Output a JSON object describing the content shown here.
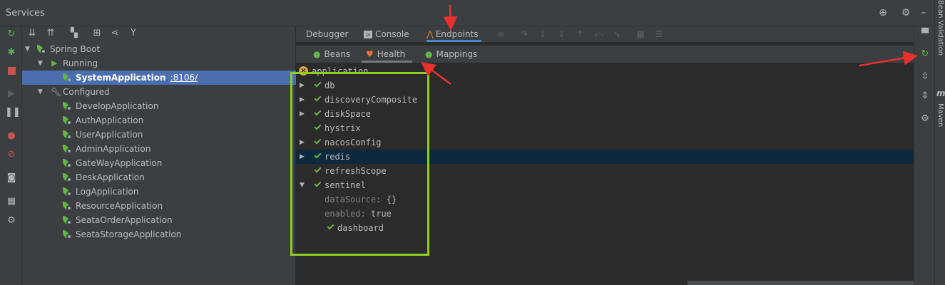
{
  "header": {
    "title": "Services"
  },
  "side_tabs": {
    "bean_validation": "Bean Validation",
    "maven": "Maven",
    "maven_glyph": "m"
  },
  "tree": {
    "spring_boot": "Spring Boot",
    "running": "Running",
    "running_app": {
      "name": "SystemApplication",
      "port": ":8106/"
    },
    "configured": "Configured",
    "configured_apps": [
      "DevelopApplication",
      "AuthApplication",
      "UserApplication",
      "AdminApplication",
      "GateWayApplication",
      "DeskApplication",
      "LogApplication",
      "ResourceApplication",
      "SeataOrderApplication",
      "SeataStorageApplication"
    ]
  },
  "tabs": {
    "debugger": "Debugger",
    "console": "Console",
    "endpoints": "Endpoints",
    "active": "Endpoints"
  },
  "subtabs": {
    "beans": "Beans",
    "health": "Health",
    "mappings": "Mappings",
    "active": "Health"
  },
  "health": {
    "root": "application",
    "components": [
      {
        "name": "db",
        "expandable": true
      },
      {
        "name": "discoveryComposite",
        "expandable": true
      },
      {
        "name": "diskSpace",
        "expandable": true
      },
      {
        "name": "hystrix",
        "expandable": false
      },
      {
        "name": "nacosConfig",
        "expandable": true
      },
      {
        "name": "redis",
        "expandable": true,
        "highlighted": true
      },
      {
        "name": "refreshScope",
        "expandable": false
      },
      {
        "name": "sentinel",
        "expandable": true,
        "expanded": true
      }
    ],
    "sentinel_props": [
      {
        "key": "dataSource:",
        "value": "{}"
      },
      {
        "key": "enabled:",
        "value": "true"
      }
    ],
    "sentinel_child": "dashboard"
  },
  "colors": {
    "status_ok": "#62b543",
    "selection": "#4b6eaf",
    "row_highlight": "#0d293e",
    "annotation_box": "#8ccf1d",
    "annotation_arrow": "#e8302c",
    "error_badge": "#d9a343"
  }
}
